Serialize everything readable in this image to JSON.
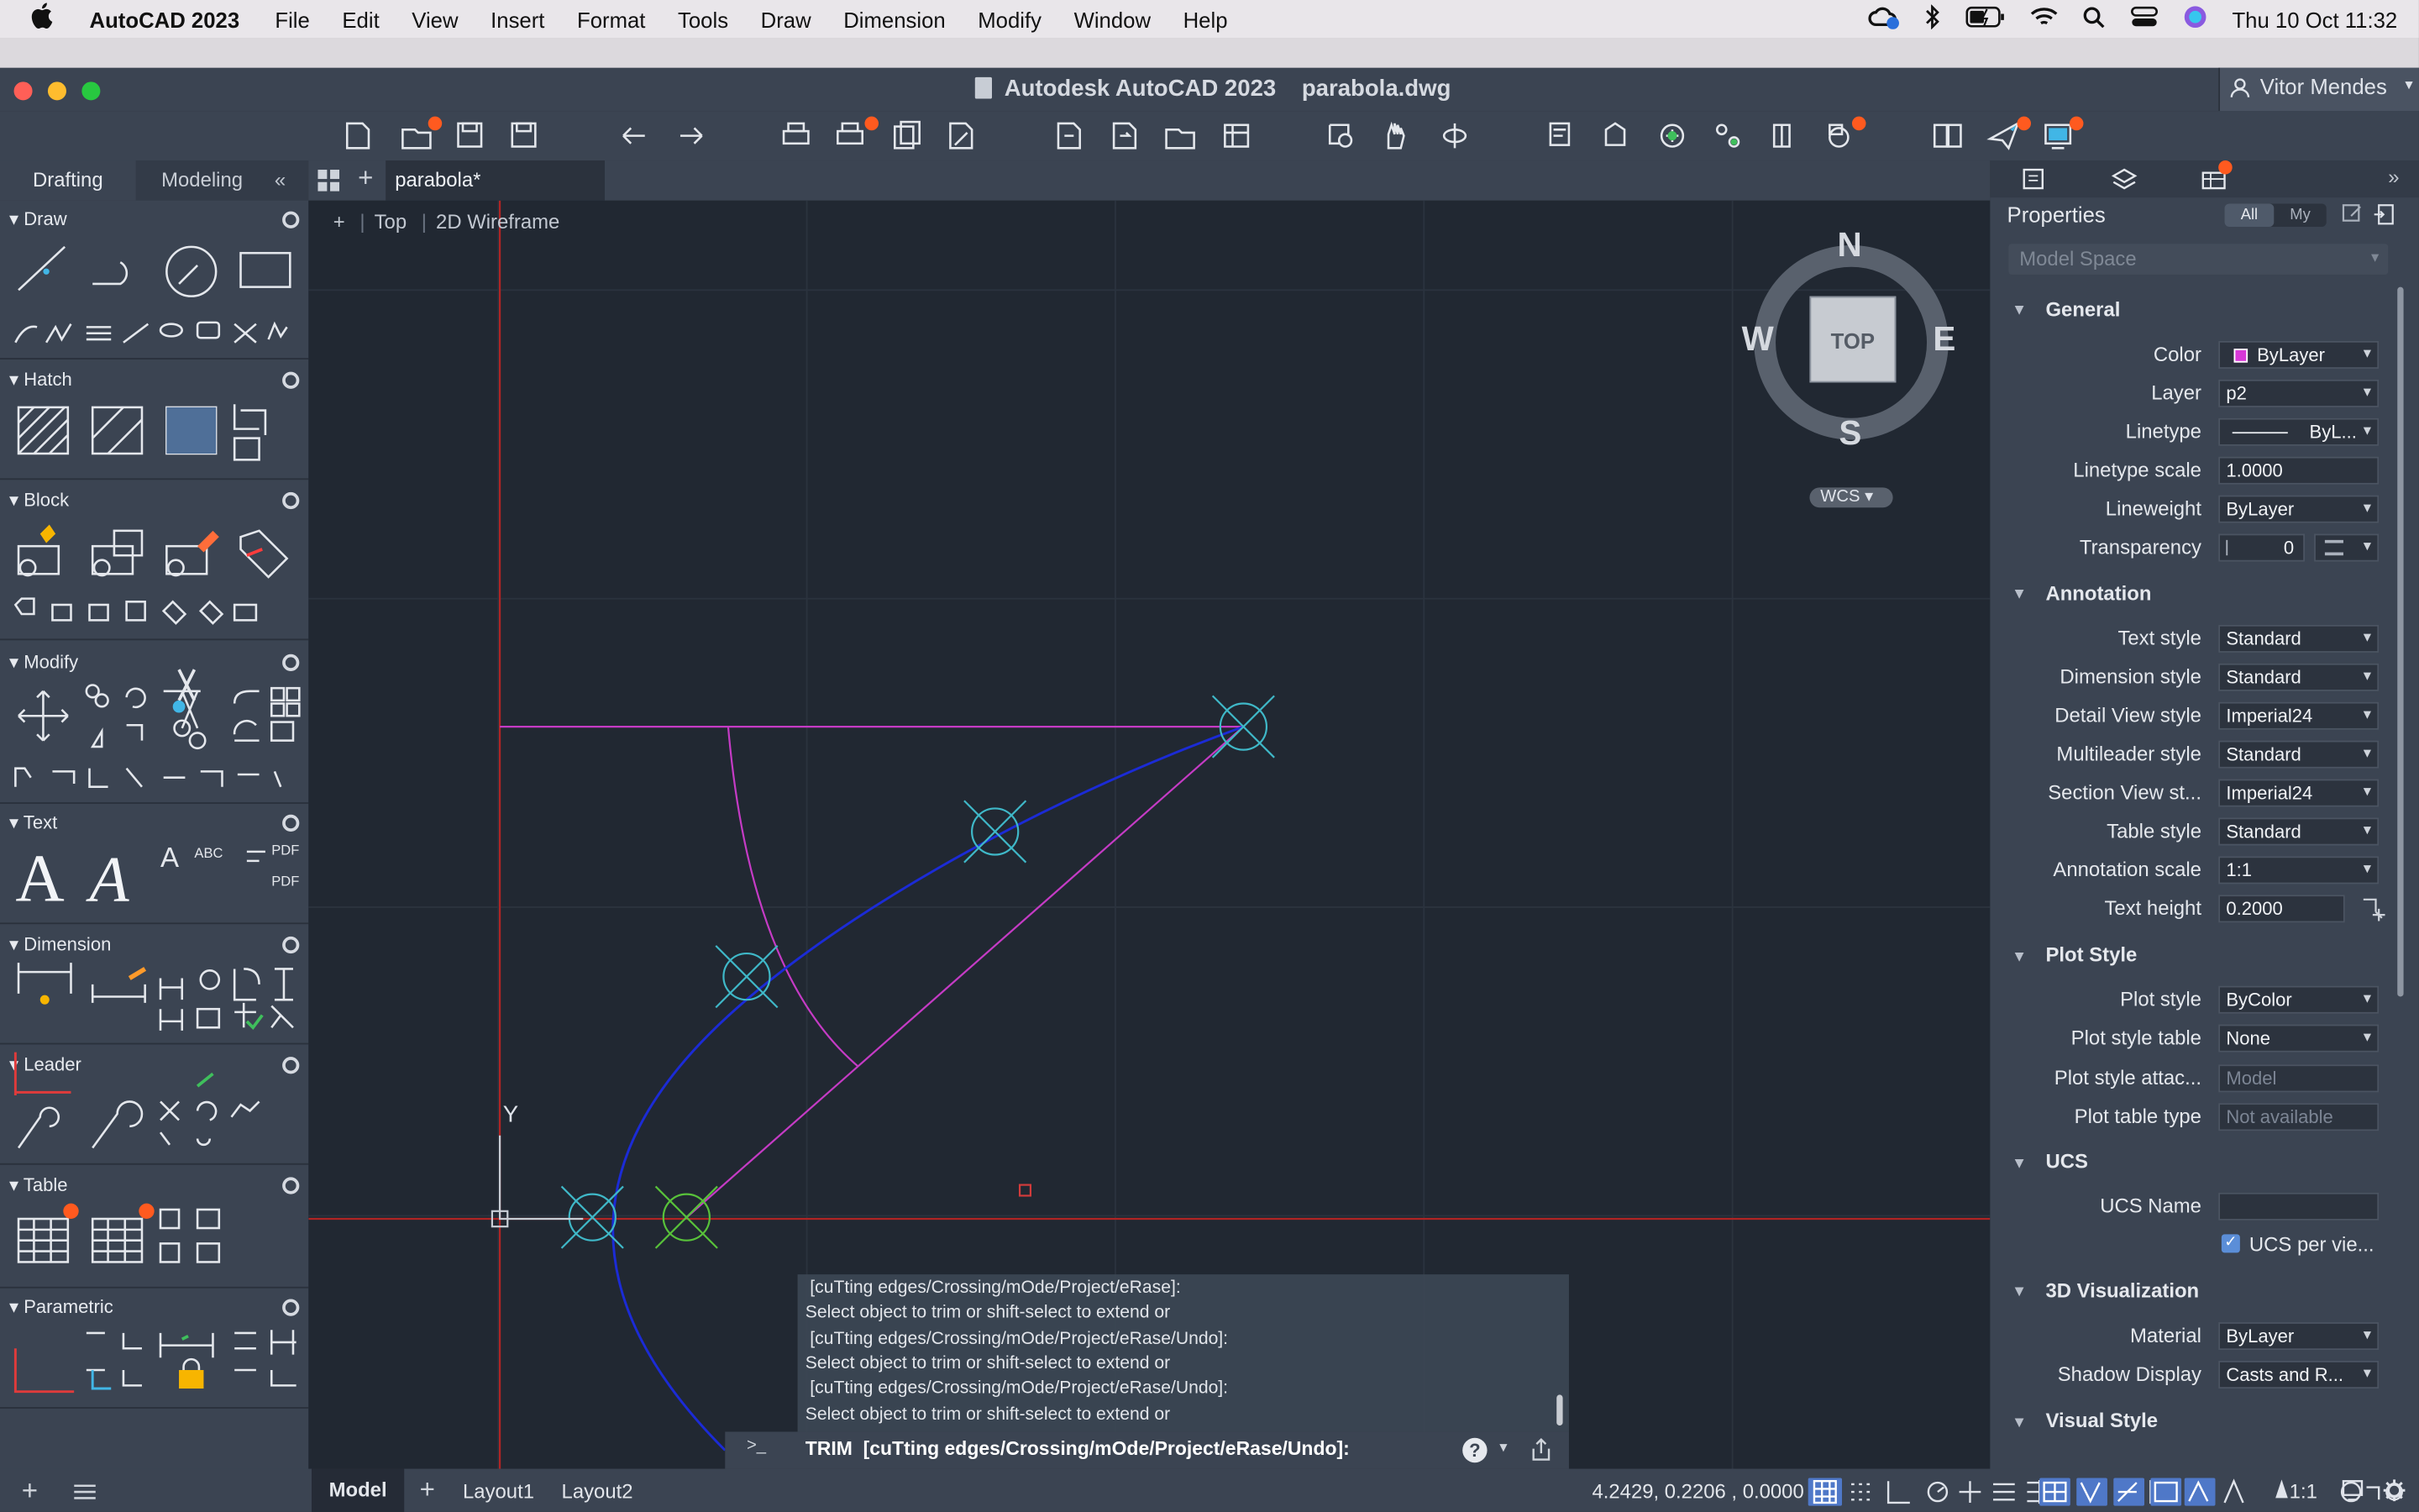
{
  "menubar": {
    "apple": "",
    "app_name": "AutoCAD 2023",
    "items": [
      "File",
      "Edit",
      "View",
      "Insert",
      "Format",
      "Tools",
      "Draw",
      "Dimension",
      "Modify",
      "Window",
      "Help"
    ],
    "datetime": "Thu 10 Oct  11:32"
  },
  "window": {
    "title": "Autodesk AutoCAD 2023    parabola.dwg",
    "user": "Vitor Mendes"
  },
  "palette": {
    "tabs": [
      "Drafting",
      "Modeling"
    ],
    "collapse": "«",
    "sections": [
      "Draw",
      "Hatch",
      "Block",
      "Modify",
      "Text",
      "Dimension",
      "Leader",
      "Table",
      "Parametric"
    ]
  },
  "file_tab": {
    "name": "parabola*"
  },
  "viewport": {
    "controls": [
      "+",
      "Top",
      "2D Wireframe"
    ],
    "viewcube": {
      "face": "TOP",
      "north": "N",
      "south": "S",
      "east": "E",
      "west": "W",
      "ucs": "WCS"
    },
    "ucs_y": "Y"
  },
  "properties": {
    "title": "Properties",
    "filter_all": "All",
    "filter_my": "My",
    "selection": "Model Space",
    "sections": {
      "general": "General",
      "annotation": "Annotation",
      "plot_style": "Plot Style",
      "ucs": "UCS",
      "viz3d": "3D Visualization",
      "visual_style": "Visual Style"
    },
    "rows": {
      "color": {
        "label": "Color",
        "value": "ByLayer",
        "swatch": "#d838d8"
      },
      "layer": {
        "label": "Layer",
        "value": "p2"
      },
      "linetype": {
        "label": "Linetype",
        "value": "ByL..."
      },
      "linetype_scale": {
        "label": "Linetype scale",
        "value": "1.0000"
      },
      "lineweight": {
        "label": "Lineweight",
        "value": "ByLayer"
      },
      "transparency": {
        "label": "Transparency",
        "value": "0"
      },
      "text_style": {
        "label": "Text style",
        "value": "Standard"
      },
      "dimension_style": {
        "label": "Dimension style",
        "value": "Standard"
      },
      "detail_view_style": {
        "label": "Detail View style",
        "value": "Imperial24"
      },
      "multileader_style": {
        "label": "Multileader style",
        "value": "Standard"
      },
      "section_view_style": {
        "label": "Section View st...",
        "value": "Imperial24"
      },
      "table_style": {
        "label": "Table style",
        "value": "Standard"
      },
      "annotation_scale": {
        "label": "Annotation scale",
        "value": "1:1"
      },
      "text_height": {
        "label": "Text height",
        "value": "0.2000"
      },
      "plot_style": {
        "label": "Plot style",
        "value": "ByColor"
      },
      "plot_style_table": {
        "label": "Plot style table",
        "value": "None"
      },
      "plot_style_attached": {
        "label": "Plot style attac...",
        "value": "Model"
      },
      "plot_table_type": {
        "label": "Plot table type",
        "value": "Not available"
      },
      "ucs_name": {
        "label": "UCS Name",
        "value": ""
      },
      "ucs_per_viewport": {
        "label": "UCS per vie...",
        "checked": true
      },
      "material": {
        "label": "Material",
        "value": "ByLayer"
      },
      "shadow_display": {
        "label": "Shadow Display",
        "value": "Casts and R..."
      }
    }
  },
  "command": {
    "history": [
      "[cuTting edges/Crossing/mOde/Project/eRase]:",
      "Select object to trim or shift-select to extend or",
      "[cuTting edges/Crossing/mOde/Project/eRase/Undo]:",
      "Select object to trim or shift-select to extend or",
      "[cuTting edges/Crossing/mOde/Project/eRase/Undo]:",
      "Select object to trim or shift-select to extend or"
    ],
    "prompt_icon": ">_",
    "current": "TRIM  [cuTting edges/Crossing/mOde/Project/eRase/Undo]:",
    "help": "?"
  },
  "status": {
    "layout_tabs": [
      "Model",
      "Layout1",
      "Layout2"
    ],
    "add": "+",
    "coordinates": "4.2429, 0.2206 , 0.0000",
    "scale": "1:1"
  },
  "colors": {
    "canvas": "#212832",
    "panel": "#3b4452",
    "magenta": "#c53bc5",
    "blue_curve": "#1b2bd6",
    "axis_red": "#b02424",
    "marker_cyan": "#3fb8c8",
    "marker_green": "#58c23a"
  }
}
